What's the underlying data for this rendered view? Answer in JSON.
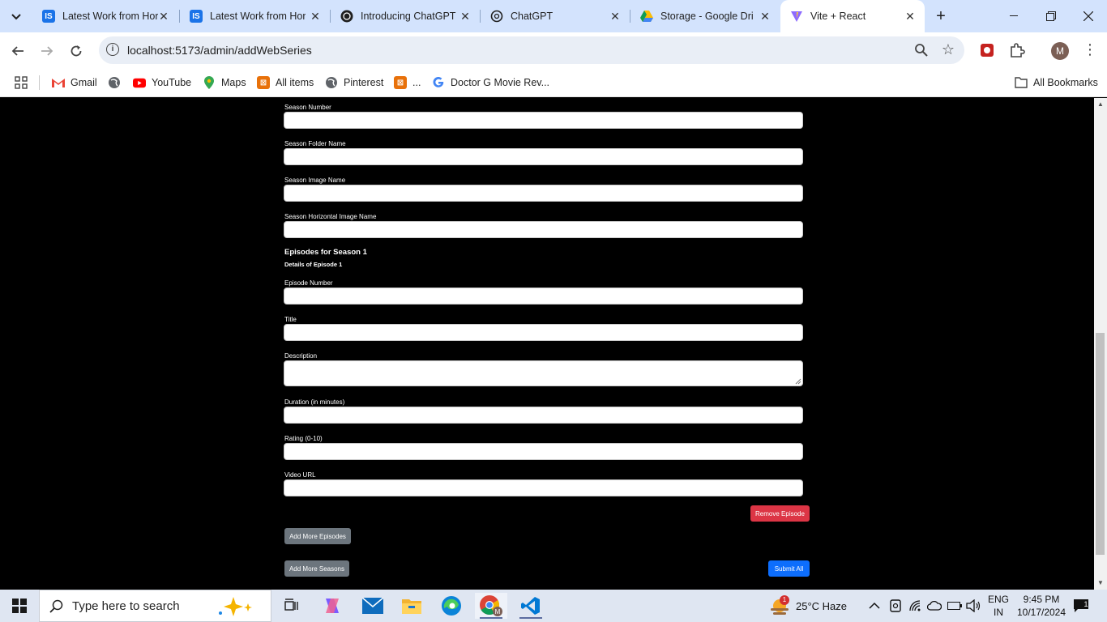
{
  "browser": {
    "tabs": [
      {
        "title": "Latest Work from Hor",
        "icon": "is-icon",
        "active": false
      },
      {
        "title": "Latest Work from Hor",
        "icon": "is-icon",
        "active": false
      },
      {
        "title": "Introducing ChatGPT",
        "icon": "openai-icon",
        "active": false
      },
      {
        "title": "ChatGPT",
        "icon": "openai-icon",
        "active": false
      },
      {
        "title": "Storage - Google Dri",
        "icon": "google-drive-icon",
        "active": false
      },
      {
        "title": "Vite + React",
        "icon": "vite-icon",
        "active": true
      }
    ],
    "url": "localhost:5173/admin/addWebSeries",
    "avatar_letter": "M"
  },
  "bookmarks": {
    "items": [
      "Gmail",
      "",
      "YouTube",
      "Maps",
      "All items",
      "Pinterest",
      "...",
      "Doctor G Movie Rev..."
    ],
    "all_bookmarks": "All Bookmarks"
  },
  "form": {
    "season_number_label": "Season Number",
    "season_folder_label": "Season Folder Name",
    "season_image_label": "Season Image Name",
    "season_horizontal_image_label": "Season Horizontal Image Name",
    "episodes_heading": "Episodes for Season 1",
    "episode_details_heading": "Details of Episode 1",
    "episode_number_label": "Episode Number",
    "title_label": "Title",
    "description_label": "Description",
    "duration_label": "Duration (in minutes)",
    "rating_label": "Rating (0-10)",
    "video_url_label": "Video URL",
    "remove_episode": "Remove Episode",
    "add_more_episodes": "Add More Episodes",
    "add_more_seasons": "Add More Seasons",
    "submit_all": "Submit All"
  },
  "colors": {
    "remove": "#dc3545",
    "secondary": "#6c757d",
    "primary": "#0d6efd"
  },
  "taskbar": {
    "search_placeholder": "Type here to search",
    "weather": "25°C  Haze",
    "weather_badge": "1",
    "lang_1": "ENG",
    "lang_2": "IN",
    "time": "9:45 PM",
    "date": "10/17/2024",
    "notif_count": "1"
  }
}
